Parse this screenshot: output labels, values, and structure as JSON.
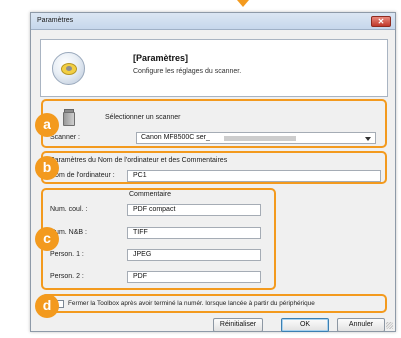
{
  "window": {
    "title": "Paramètres",
    "close_symbol": "✕"
  },
  "header": {
    "title": "[Paramètres]",
    "description": "Configure les réglages du scanner.",
    "icon": "scanner-disc-icon"
  },
  "scanner_section": {
    "badge": "a",
    "select_label": "Sélectionner un scanner",
    "scanner_label": "Scanner :",
    "scanner_value": "Canon MF8500C ser_"
  },
  "computer_section": {
    "badge": "b",
    "heading": "Paramètres du Nom de l'ordinateur et des Commentaires",
    "name_label": "Nom de l'ordinateur :",
    "name_value": "PC1"
  },
  "comments_section": {
    "badge": "c",
    "column_header": "Commentaire",
    "rows": [
      {
        "label": "Num. coul. :",
        "value": "PDF compact"
      },
      {
        "label": "Num. N&B :",
        "value": "TIFF"
      },
      {
        "label": "Person. 1 :",
        "value": "JPEG"
      },
      {
        "label": "Person. 2 :",
        "value": "PDF"
      }
    ]
  },
  "toolbox_option": {
    "badge": "d",
    "label": "Fermer la Toolbox après avoir terminé la numér. lorsque lancée à partir du périphérique",
    "checked": false
  },
  "buttons": {
    "reset": "Réinitialiser",
    "ok": "OK",
    "cancel": "Annuler"
  },
  "colors": {
    "accent": "#f39a1e",
    "window_bg": "#f0f0f0",
    "titlebar": "#c6d7ec",
    "close_button": "#c0392b"
  }
}
